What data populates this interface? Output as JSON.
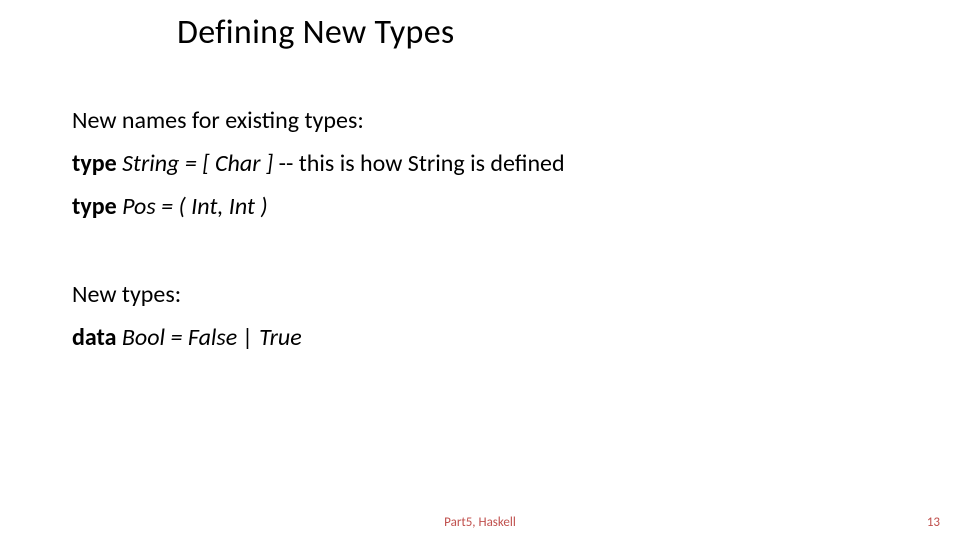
{
  "title": "Defining New Types",
  "section1_heading": "New names for existing types:",
  "line_type_string_kw": "type",
  "line_type_string_body": " String = [ Char ]",
  "line_type_string_comment": "   -- this is how String  is defined",
  "line_type_pos_kw": "type",
  "line_type_pos_body": " Pos = ( Int, Int )",
  "section2_heading": "New types:",
  "line_data_bool_kw": "data",
  "line_data_bool_body": " Bool = False | True",
  "footer_center": "Part5, Haskell",
  "footer_right": "13"
}
